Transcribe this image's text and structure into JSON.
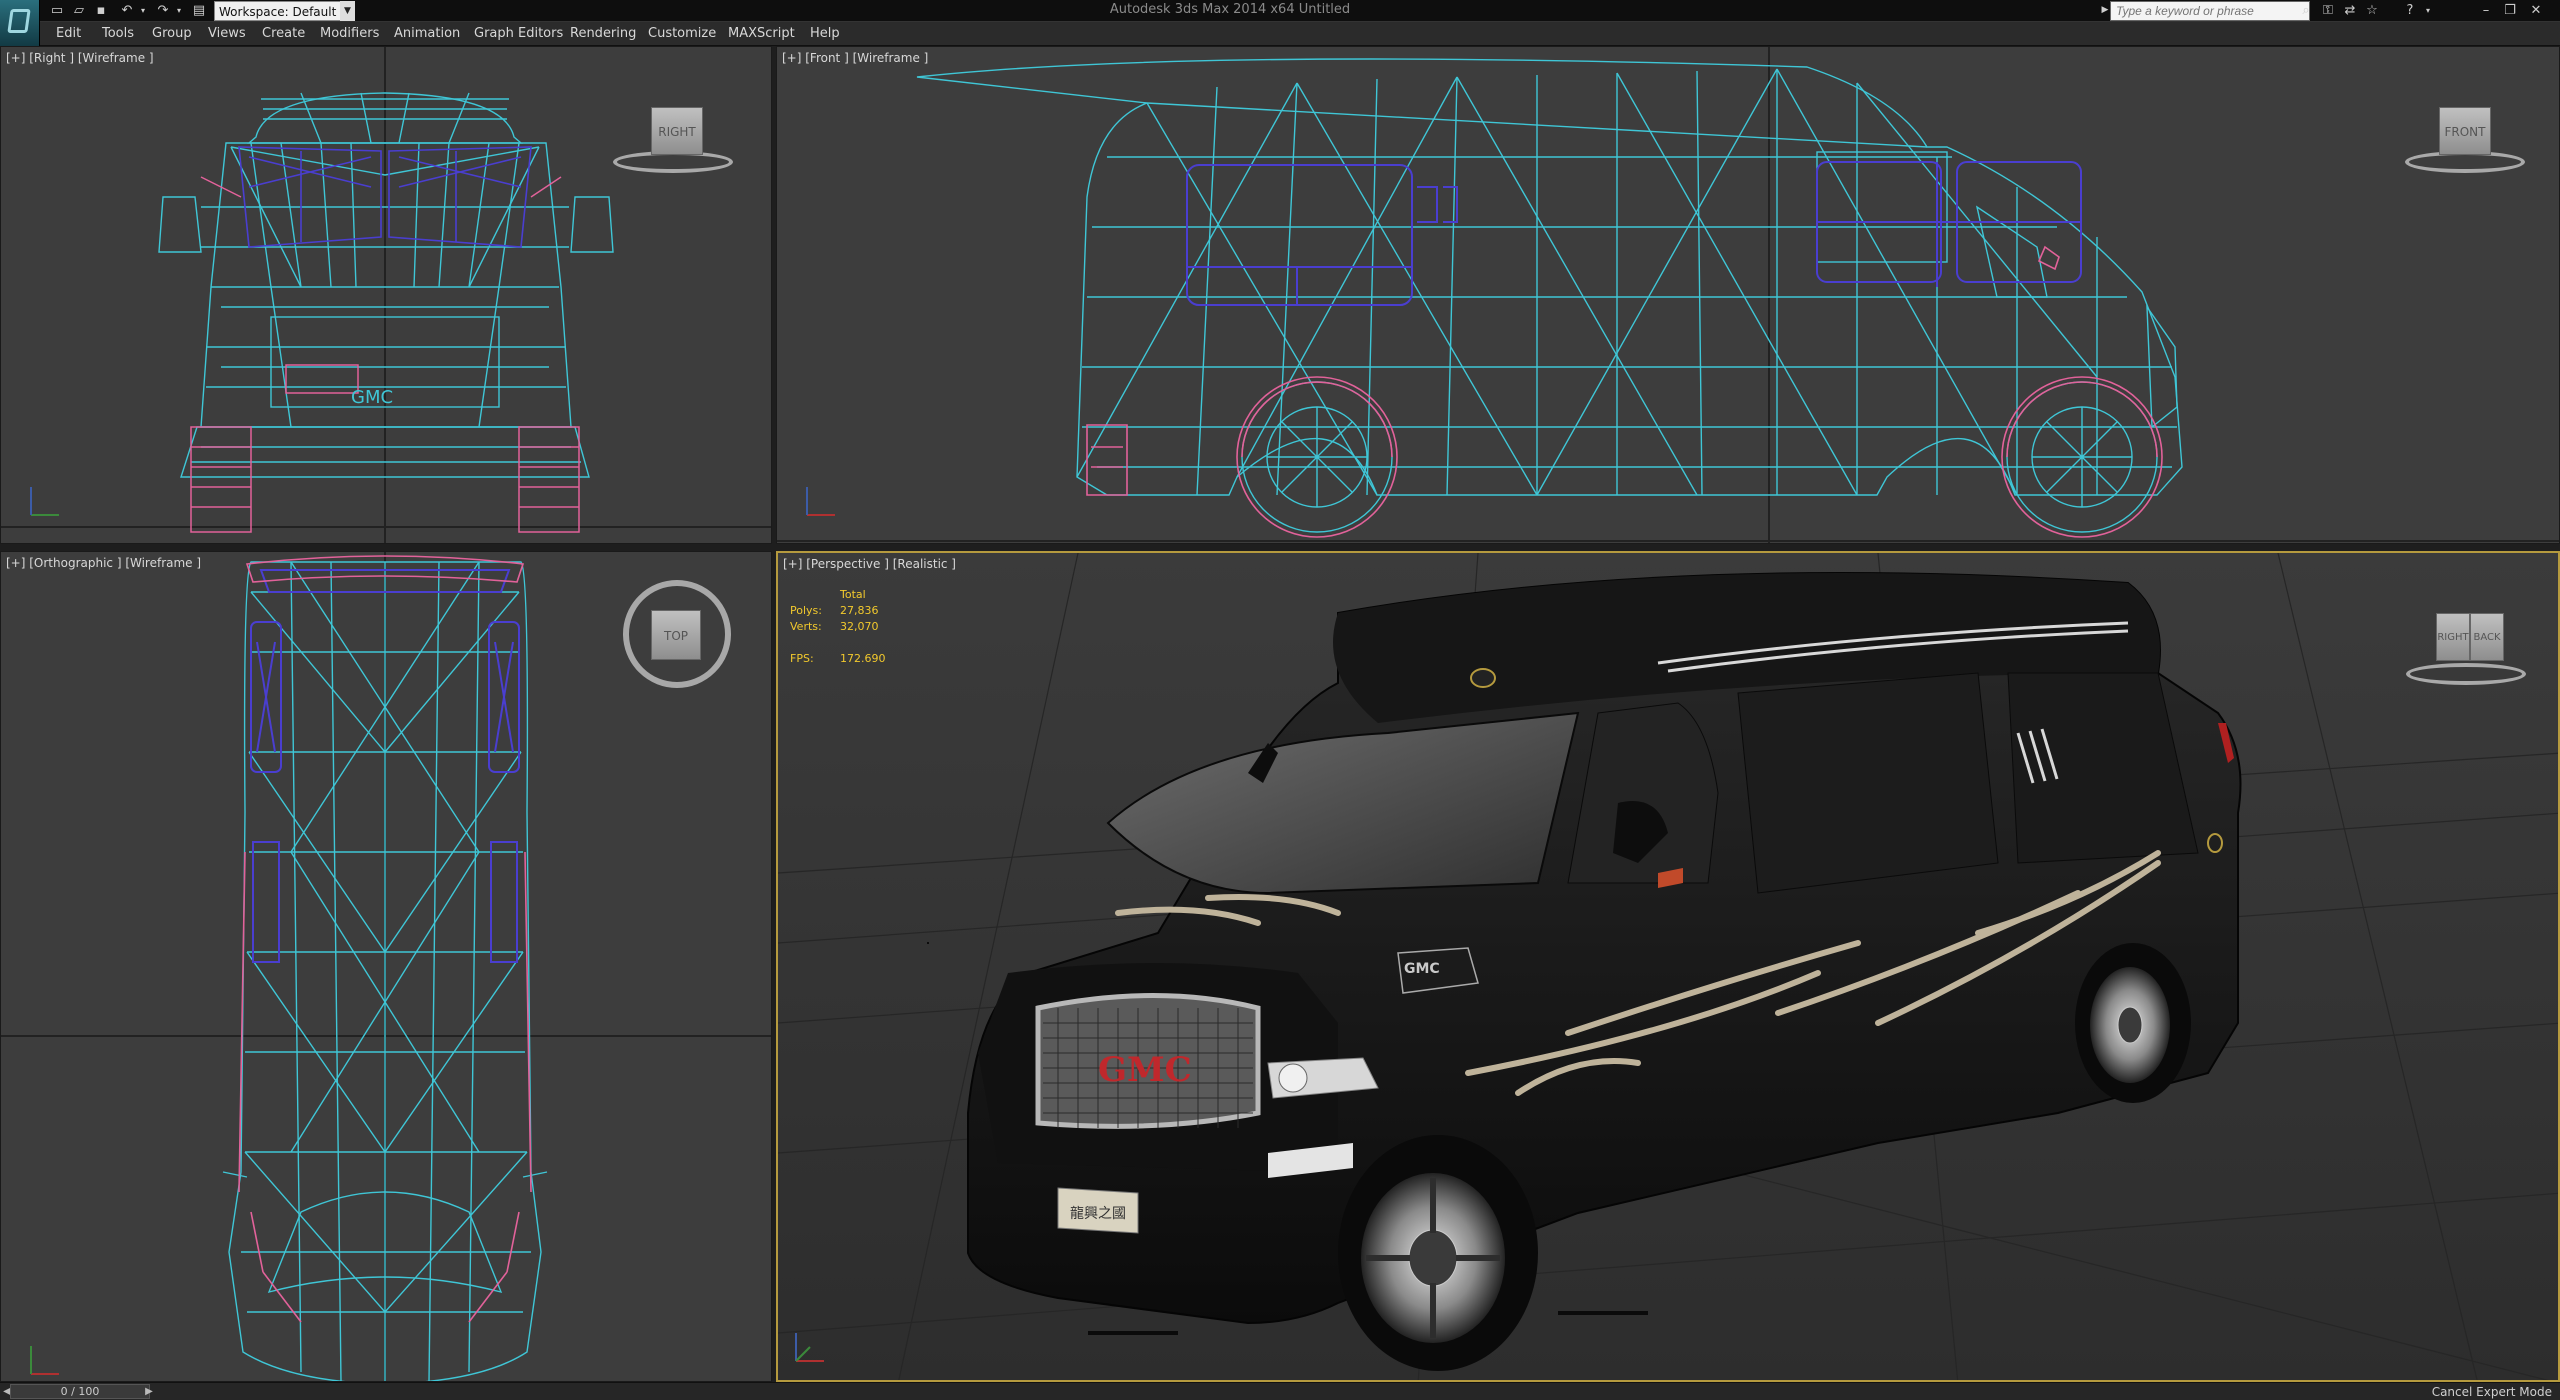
{
  "window": {
    "title": "Autodesk 3ds Max  2014 x64     Untitled",
    "workspace": "Workspace: Default",
    "search_placeholder": "Type a keyword or phrase"
  },
  "menu": [
    "Edit",
    "Tools",
    "Group",
    "Views",
    "Create",
    "Modifiers",
    "Animation",
    "Graph Editors",
    "Rendering",
    "Customize",
    "MAXScript",
    "Help"
  ],
  "viewports": {
    "right": {
      "label": "[+] [Right ] [Wireframe ]",
      "cube": "RIGHT"
    },
    "front": {
      "label": "[+] [Front ] [Wireframe ]",
      "cube": "FRONT"
    },
    "ortho": {
      "label": "[+] [Orthographic ] [Wireframe ]",
      "cube": "TOP"
    },
    "persp": {
      "label": "[+] [Perspective ] [Realistic ]",
      "cube_left": "RIGHT",
      "cube_right": "BACK"
    }
  },
  "stats": {
    "total_label": "Total",
    "polys_label": "Polys:",
    "polys_value": "27,836",
    "verts_label": "Verts:",
    "verts_value": "32,070",
    "fps_label": "FPS:",
    "fps_value": "172.690"
  },
  "badges": {
    "grille_logo": "GMC",
    "door_logo": "GMC",
    "plate_text": "龍興之國"
  },
  "statusbar": {
    "time": "0 / 100",
    "mode": "Cancel Expert Mode"
  },
  "colors": {
    "wire_cyan": "#3fc6d6",
    "wire_pink": "#e2629a",
    "wire_blue": "#4a3ed0",
    "active_border": "#b59a3e",
    "stats_text": "#f2c92d"
  }
}
